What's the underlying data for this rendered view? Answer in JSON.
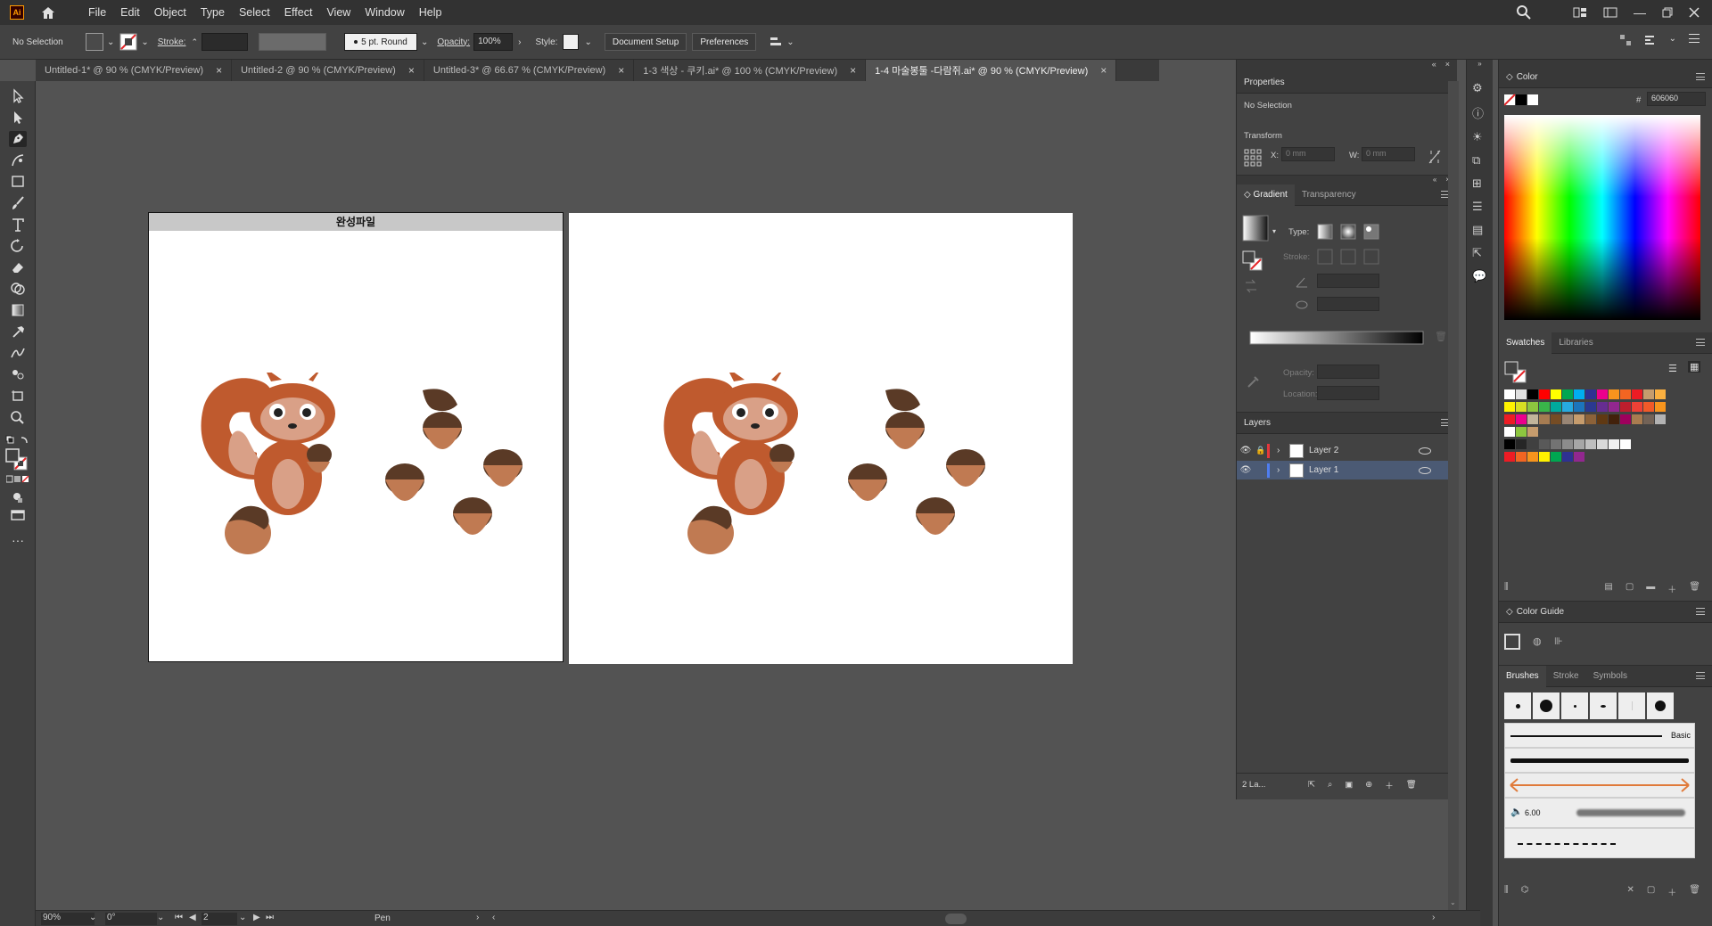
{
  "app": {
    "logo": "Ai"
  },
  "menu": [
    "File",
    "Edit",
    "Object",
    "Type",
    "Select",
    "Effect",
    "View",
    "Window",
    "Help"
  ],
  "control": {
    "selection": "No Selection",
    "stroke_label": "Stroke:",
    "brush": "5 pt. Round",
    "opacity_label": "Opacity:",
    "opacity_value": "100%",
    "style_label": "Style:",
    "document_setup": "Document Setup",
    "preferences": "Preferences"
  },
  "tabs": [
    {
      "label": "Untitled-1* @ 90 % (CMYK/Preview)"
    },
    {
      "label": "Untitled-2 @ 90 % (CMYK/Preview)"
    },
    {
      "label": "Untitled-3* @ 66.67 % (CMYK/Preview)"
    },
    {
      "label": "1-3 색상 - 쿠키.ai* @ 100 % (CMYK/Preview)"
    },
    {
      "label": "1-4 마술봉툴 -다람쥐.ai* @ 90 % (CMYK/Preview)"
    }
  ],
  "artboard1": {
    "title": "완성파일"
  },
  "properties": {
    "title": "Properties",
    "selection": "No Selection",
    "transform": "Transform",
    "x_label": "X:",
    "x_value": "0 mm",
    "w_label": "W:",
    "w_value": "0 mm"
  },
  "gradient": {
    "tab1": "Gradient",
    "tab2": "Transparency",
    "type_label": "Type:",
    "stroke_label": "Stroke:",
    "opacity_label": "Opacity:",
    "location_label": "Location:"
  },
  "layers": {
    "title": "Layers",
    "items": [
      {
        "name": "Layer 2",
        "color": "#e5373c"
      },
      {
        "name": "Layer 1",
        "color": "#4f7df0"
      }
    ],
    "count": "2 La..."
  },
  "color": {
    "title": "Color",
    "hex_label": "#",
    "hex": "606060"
  },
  "swatches": {
    "tab1": "Swatches",
    "tab2": "Libraries"
  },
  "colorguide": {
    "title": "Color Guide"
  },
  "brushes": {
    "tab1": "Brushes",
    "tab2": "Stroke",
    "tab3": "Symbols",
    "basic": "Basic",
    "size": "6.00"
  },
  "status": {
    "zoom": "90%",
    "rotate": "0°",
    "page": "2",
    "tool": "Pen"
  }
}
